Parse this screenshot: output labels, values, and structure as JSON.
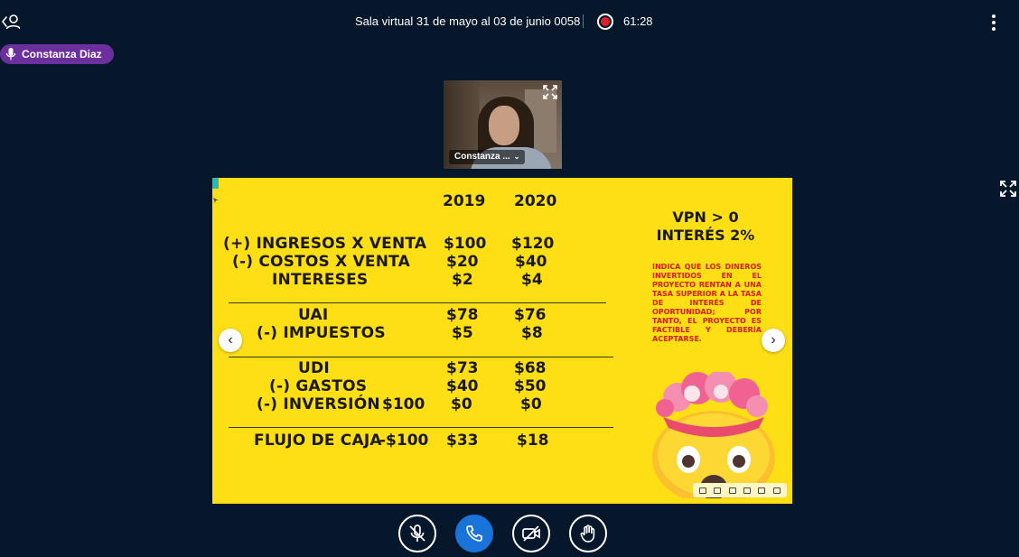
{
  "header": {
    "session_title": "Sala virtual 31 de mayo al 03 de junio 0058",
    "timer": "61:28"
  },
  "speaker": {
    "name": "Constanza Diaz"
  },
  "webcam": {
    "name_label": "Constanza ..."
  },
  "slide": {
    "years": [
      "2019",
      "2020"
    ],
    "rows": [
      {
        "label": "(+) INGRESOS X VENTA",
        "v2019": "$100",
        "v2020": "$120"
      },
      {
        "label": "(-) COSTOS X VENTA",
        "v2019": "$20",
        "v2020": "$40"
      },
      {
        "label": "INTERESES",
        "v2019": "$2",
        "v2020": "$4"
      },
      {
        "label": "UAI",
        "v2019": "$78",
        "v2020": "$76"
      },
      {
        "label": "(-) IMPUESTOS",
        "v2019": "$5",
        "v2020": "$8"
      },
      {
        "label": "UDI",
        "v2019": "$73",
        "v2020": "$68"
      },
      {
        "label": "(-) GASTOS",
        "v2019": "$40",
        "v2020": "$50"
      },
      {
        "label": "(-) INVERSIÓN",
        "v0": "$100",
        "v2019": "$0",
        "v2020": "$0"
      },
      {
        "label": "FLUJO DE CAJA",
        "v0": "-$100",
        "v2019": "$33",
        "v2020": "$18"
      }
    ],
    "vpn_line1": "VPN > 0",
    "vpn_line2": "INTERÉS 2%",
    "note": "INDICA QUE LOS DINEROS INVERTIDOS EN EL PROYECTO RENTAN A UNA TASA SUPERIOR A LA TASA DE INTERÉS DE OPORTUNIDAD; POR TANTO, EL PROYECTO ES FACTIBLE Y DEBERÍA ACEPTARSE."
  },
  "colors": {
    "background": "#06172b",
    "slide": "#fede15",
    "speaker_chip": "#6b2f9e",
    "note_text": "#d51c1c",
    "call_button": "#1a73d9",
    "record": "#e01f2c"
  },
  "icons": {
    "user": "user-icon",
    "record": "record-icon",
    "menu": "more-vertical-icon",
    "mic": "microphone-icon",
    "expand": "expand-icon",
    "prev": "chevron-left-icon",
    "next": "chevron-right-icon",
    "mute": "mic-off-icon",
    "call": "phone-icon",
    "video": "video-off-icon",
    "hand": "raise-hand-icon"
  }
}
